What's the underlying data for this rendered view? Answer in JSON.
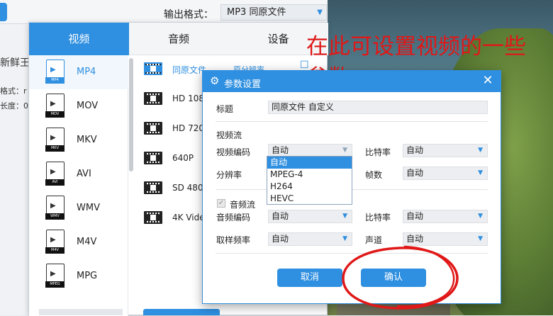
{
  "output": {
    "label": "输出格式：",
    "selected": "MP3  同原文件"
  },
  "background_left": {
    "line1": "新鲜王",
    "line2": "格式：r",
    "line3": "长度：0"
  },
  "tabs": [
    {
      "label": "视频",
      "active": true
    },
    {
      "label": "音频",
      "active": false
    },
    {
      "label": "设备",
      "active": false
    }
  ],
  "formats": [
    {
      "name": "MP4",
      "tag": "MP4",
      "active": true
    },
    {
      "name": "MOV",
      "tag": "MOV",
      "active": false
    },
    {
      "name": "MKV",
      "tag": "MKV",
      "active": false
    },
    {
      "name": "AVI",
      "tag": "AVI",
      "active": false
    },
    {
      "name": "WMV",
      "tag": "WMV",
      "active": false
    },
    {
      "name": "M4V",
      "tag": "M4V",
      "active": false
    },
    {
      "name": "MPG",
      "tag": "MPEG",
      "active": false
    }
  ],
  "presets": [
    {
      "name": "同原文件",
      "extra": "原分辨率",
      "active": true
    },
    {
      "name": "HD 108",
      "active": false
    },
    {
      "name": "HD 720",
      "active": false
    },
    {
      "name": "640P",
      "active": false
    },
    {
      "name": "SD 480",
      "active": false
    },
    {
      "name": "4K Vide",
      "active": false
    }
  ],
  "annotation": "在此可设置视频的一些参数",
  "dialog": {
    "title": "参数设置",
    "title_label": "标题",
    "title_value": "同原文件 自定义",
    "video_section": "视频流",
    "video_codec_label": "视频编码",
    "video_codec_value": "自动",
    "video_bitrate_label": "比特率",
    "video_bitrate_value": "自动",
    "resolution_label": "分辨率",
    "fps_label": "帧数",
    "fps_value": "自动",
    "codec_options": [
      "自动",
      "MPEG-4",
      "H264",
      "HEVC"
    ],
    "audio_section": "音频流",
    "audio_codec_label": "音频编码",
    "audio_codec_value": "自动",
    "audio_bitrate_label": "比特率",
    "audio_bitrate_value": "自动",
    "sample_rate_label": "取样频率",
    "sample_rate_value": "自动",
    "channel_label": "声道",
    "channel_value": "自动",
    "cancel_label": "取消",
    "confirm_label": "确认"
  },
  "colors": {
    "accent": "#2f8fe0",
    "annotation": "#e01818"
  }
}
